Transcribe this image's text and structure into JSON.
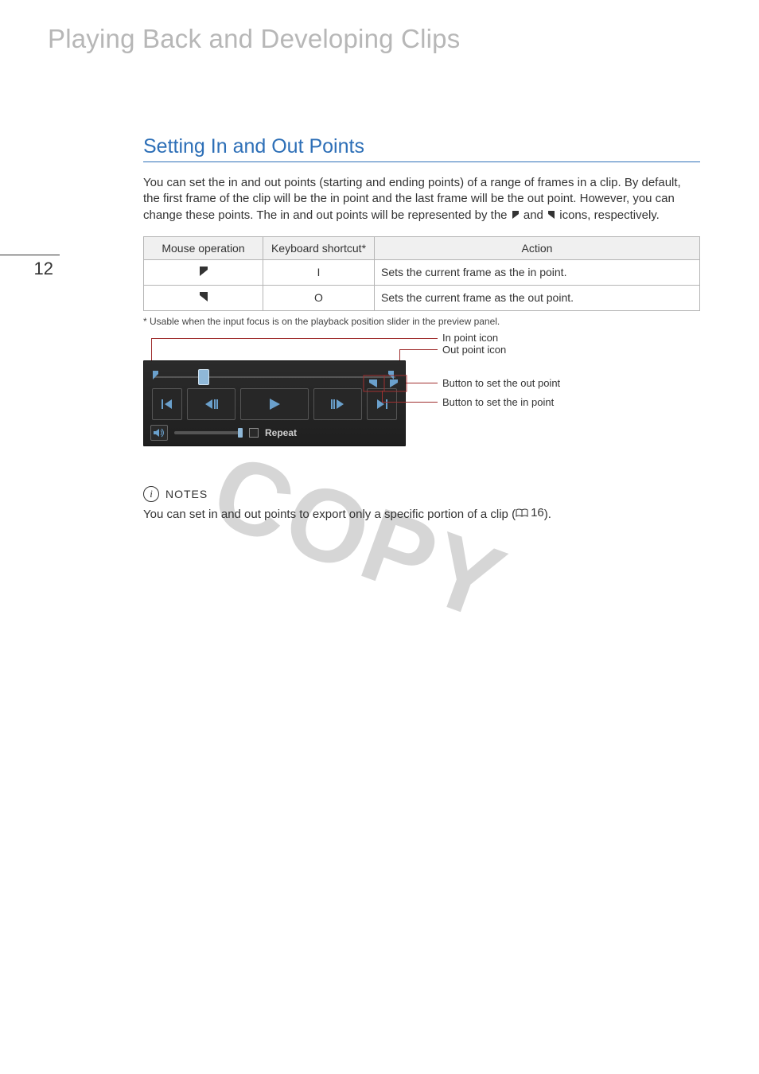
{
  "chapter_title": "Playing Back and Developing Clips",
  "page_number": "12",
  "section_heading": "Setting In and Out Points",
  "intro_part1": "You can set the in and out points (starting and ending points) of a range of frames in a clip. By default, the first frame of the clip will be the in point and the last frame will be the out point. However, you can change these points. The in and out points will be represented by the ",
  "intro_part2": " and ",
  "intro_part3": " icons, respectively.",
  "table": {
    "headers": {
      "mouse": "Mouse operation",
      "shortcut": "Keyboard shortcut*",
      "action": "Action"
    },
    "rows": [
      {
        "shortcut": "I",
        "action": "Sets the current frame as the in point."
      },
      {
        "shortcut": "O",
        "action": "Sets the current frame as the out point."
      }
    ]
  },
  "footnote": "* Usable when the input focus is on the playback position slider in the preview panel.",
  "labels": {
    "in_point_icon": "In point icon",
    "out_point_icon": "Out point icon",
    "btn_out": "Button to set the out point",
    "btn_in": "Button to set the in point"
  },
  "player": {
    "repeat": "Repeat"
  },
  "notes": {
    "title": "NOTES",
    "body_a": "You can set in and out points to export only a specific portion of a clip (",
    "page_ref": "16",
    "body_b": ")."
  },
  "watermark": "COPY"
}
